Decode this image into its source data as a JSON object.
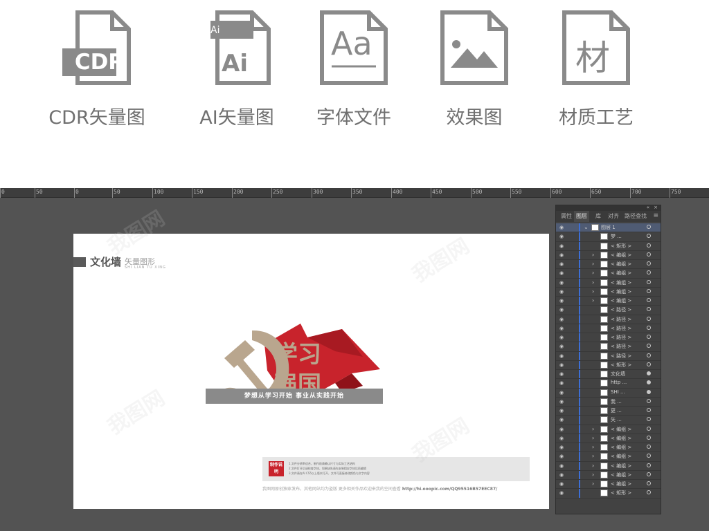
{
  "formats": [
    {
      "icon": "cdr-file-icon",
      "badge": "CDR",
      "label": "CDR矢量图"
    },
    {
      "icon": "ai-file-icon",
      "badge": "Ai",
      "label": "AI矢量图"
    },
    {
      "icon": "font-file-icon",
      "badge": "Aa",
      "label": "字体文件"
    },
    {
      "icon": "image-file-icon",
      "badge": "",
      "label": "效果图"
    },
    {
      "icon": "material-file-icon",
      "badge": "材",
      "label": "材质工艺"
    }
  ],
  "ruler": {
    "labels": [
      "0",
      "50",
      "0",
      "50",
      "100",
      "150",
      "200",
      "250",
      "300",
      "350",
      "400",
      "450",
      "500",
      "550",
      "600",
      "650",
      "700",
      "750"
    ]
  },
  "artboard": {
    "title": "文化墙",
    "subtitle": "矢量图形",
    "subtitle_pinyin": "SHI LIAN TU XING",
    "emblem_text_1": "学习",
    "emblem_text_2": "强国",
    "slogan": "梦想从学习开始  事业从实践开始",
    "stamp": "制作说明",
    "notes": [
      "1.文件分辨率适合，制作前请确认尺寸与实际工艺结构",
      "2.文件打开后请检查字体，如果缺失请先安装相应字体后再编辑",
      "3.文件请在AI CS5以上版本打开，文件可直接修改颜色与文字内容"
    ],
    "footer_text": "我图网原创独家发布，其他网站均为盗版 更多相关作品欢迎来我的空间查看",
    "footer_link": "http://hi.ooopic.com/QQ95516B57EEC87/"
  },
  "panel": {
    "tabs": [
      "属性",
      "图层",
      "库",
      "对齐",
      "路径查找"
    ],
    "active_tab": "图层",
    "layers": [
      {
        "name": "图层 1",
        "selected": true,
        "expand": true,
        "target_on": false
      },
      {
        "name": "梦 ...",
        "expand": false,
        "target_on": false
      },
      {
        "name": "< 矩形 >",
        "expand": false,
        "target_on": false
      },
      {
        "name": "< 编组 >",
        "expand": true,
        "target_on": false
      },
      {
        "name": "< 编组 >",
        "expand": true,
        "target_on": false
      },
      {
        "name": "< 编组 >",
        "expand": true,
        "target_on": false
      },
      {
        "name": "< 编组 >",
        "expand": true,
        "target_on": false
      },
      {
        "name": "< 编组 >",
        "expand": true,
        "target_on": false
      },
      {
        "name": "< 编组 >",
        "expand": true,
        "target_on": false
      },
      {
        "name": "< 路径 >",
        "expand": false,
        "target_on": false
      },
      {
        "name": "< 路径 >",
        "expand": false,
        "target_on": false
      },
      {
        "name": "< 路径 >",
        "expand": false,
        "target_on": false
      },
      {
        "name": "< 路径 >",
        "expand": false,
        "target_on": false
      },
      {
        "name": "< 路径 >",
        "expand": false,
        "target_on": false
      },
      {
        "name": "< 路径 >",
        "expand": false,
        "target_on": false
      },
      {
        "name": "< 矩形 >",
        "expand": false,
        "target_on": false
      },
      {
        "name": "文化墙",
        "expand": false,
        "target_on": true
      },
      {
        "name": "http ...",
        "expand": false,
        "target_on": true
      },
      {
        "name": "SHI ...",
        "expand": false,
        "target_on": true
      },
      {
        "name": "我 ...",
        "expand": false,
        "target_on": false
      },
      {
        "name": "更 ...",
        "expand": false,
        "target_on": false
      },
      {
        "name": "矢 ...",
        "expand": false,
        "target_on": false
      },
      {
        "name": "< 编组 >",
        "expand": true,
        "target_on": false
      },
      {
        "name": "< 编组 >",
        "expand": true,
        "target_on": false
      },
      {
        "name": "< 编组 >",
        "expand": true,
        "target_on": false
      },
      {
        "name": "< 编组 >",
        "expand": true,
        "target_on": false
      },
      {
        "name": "< 编组 >",
        "expand": true,
        "target_on": false
      },
      {
        "name": "< 编组 >",
        "expand": true,
        "target_on": false
      },
      {
        "name": "< 编组 >",
        "expand": true,
        "target_on": false
      },
      {
        "name": "< 矩形 >",
        "expand": false,
        "target_on": false
      }
    ]
  },
  "colors": {
    "icon_gray": "#8a8a8a",
    "workspace": "#535353",
    "panel": "#424242",
    "selection": "#4f5b73",
    "layer_stripe": "#3d6fd6",
    "flag_red": "#c8232c",
    "emblem_tan": "#b9a68e"
  }
}
